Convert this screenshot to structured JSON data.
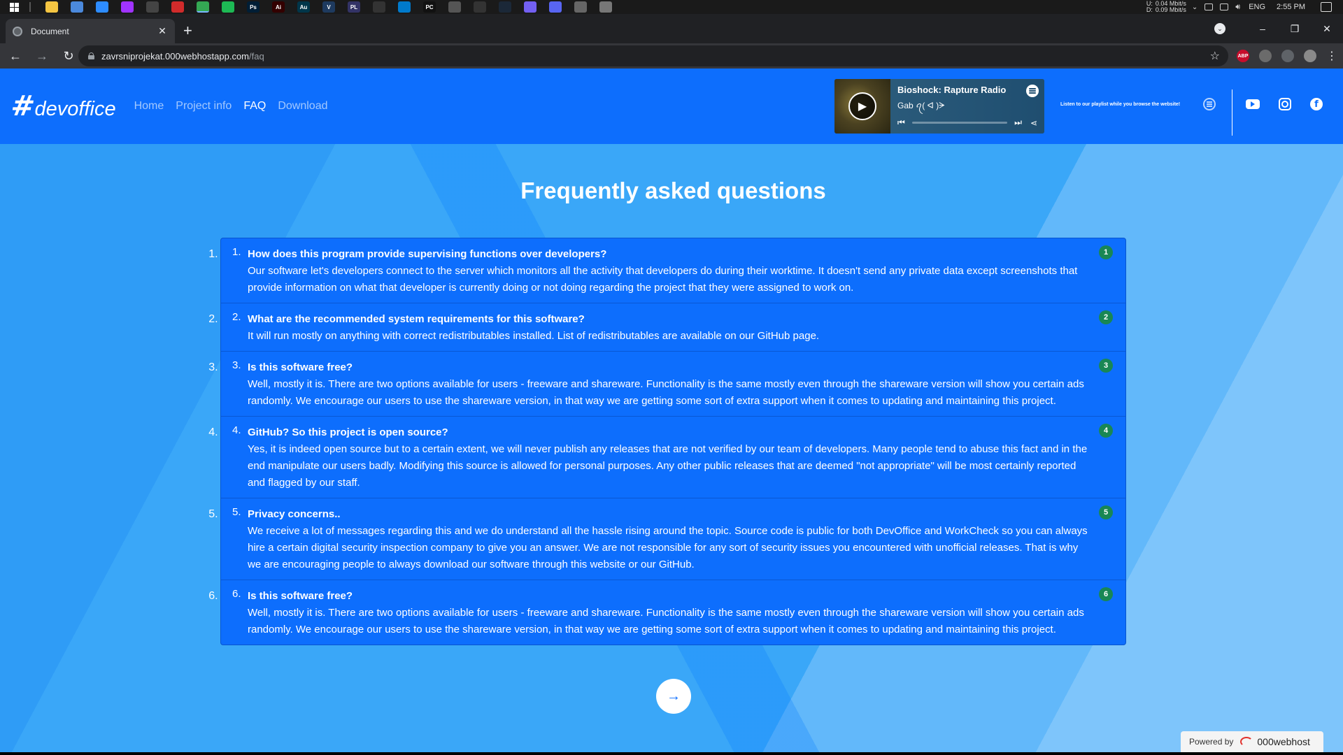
{
  "taskbar": {
    "apps": [
      {
        "name": "start-menu"
      },
      {
        "name": "file-explorer-icon",
        "color": "#f4c542"
      },
      {
        "name": "browser-app-icon",
        "color": "#4b89dc"
      },
      {
        "name": "zoom-icon",
        "color": "#2d8cff"
      },
      {
        "name": "messenger-icon",
        "color": "#a033ff"
      },
      {
        "name": "github-app-icon",
        "color": "#444444"
      },
      {
        "name": "media-app-icon",
        "color": "#d12b2b"
      },
      {
        "name": "chrome-icon",
        "color": "#34a853"
      },
      {
        "name": "spotify-app-icon",
        "color": "#1db954"
      },
      {
        "name": "photoshop-icon",
        "color": "#001e36",
        "text": "Ps"
      },
      {
        "name": "illustrator-icon",
        "color": "#330000",
        "text": "Ai"
      },
      {
        "name": "audition-icon",
        "color": "#00364a",
        "text": "Au"
      },
      {
        "name": "visual-studio-icon",
        "color": "#1e3a5f",
        "text": "V"
      },
      {
        "name": "plugin-app-icon",
        "color": "#333366",
        "text": "PL"
      },
      {
        "name": "cursor-app-icon",
        "color": "#333333"
      },
      {
        "name": "vscode-icon",
        "color": "#007acc"
      },
      {
        "name": "pycharm-icon",
        "color": "#111111",
        "text": "PC"
      },
      {
        "name": "app-bar-icon",
        "color": "#555555"
      },
      {
        "name": "terminal-icon",
        "color": "#333333"
      },
      {
        "name": "steam-icon",
        "color": "#1b2838"
      },
      {
        "name": "viber-icon",
        "color": "#7360f2"
      },
      {
        "name": "discord-icon",
        "color": "#5865f2"
      },
      {
        "name": "app-cloud-icon",
        "color": "#666666"
      },
      {
        "name": "remote-desktop-icon",
        "color": "#777777"
      }
    ],
    "net_labels": [
      "U:",
      "D:"
    ],
    "net_values": [
      "0.04 Mbit/s",
      "0.09 Mbit/s"
    ],
    "language": "ENG",
    "time": "2:55 PM"
  },
  "browser": {
    "tab_title": "Document",
    "tab_close": "✕",
    "new_tab": "+",
    "url_host": "zavrsniprojekat.000webhostapp.com",
    "url_path": "/faq",
    "extensions": [
      {
        "name": "adblock-extension-icon",
        "text": "ABP",
        "color": "#c70d2c"
      },
      {
        "name": "extension-icon",
        "text": "",
        "color": "#6b6b6b"
      },
      {
        "name": "puzzle-extensions-icon",
        "text": "",
        "color": "#5f6368"
      },
      {
        "name": "profile-avatar-icon",
        "text": "",
        "color": "#8a8a8a"
      }
    ]
  },
  "site": {
    "logo_hash": "#",
    "logo_text": "devoffice",
    "nav": [
      {
        "label": "Home",
        "active": false
      },
      {
        "label": "Project info",
        "active": false
      },
      {
        "label": "FAQ",
        "active": true
      },
      {
        "label": "Download",
        "active": false
      }
    ],
    "player": {
      "title": "Bioshock: Rapture Radio",
      "artist": "Gab ꪖ( ᐊ )ᗒ"
    },
    "playlist_note": "Listen to our playlist while you browse the website!",
    "social": [
      "spotify",
      "youtube",
      "instagram",
      "facebook"
    ]
  },
  "faq": {
    "title": "Frequently asked questions",
    "items": [
      {
        "num": "1.",
        "badge": "1",
        "question": "How does this program provide supervising functions over developers?",
        "answer": "Our software let's developers connect to the server which monitors all the activity that developers do during their worktime. It doesn't send any private data except screenshots that provide information on what that developer is currently doing or not doing regarding the project that they were assigned to work on."
      },
      {
        "num": "2.",
        "badge": "2",
        "question": "What are the recommended system requirements for this software?",
        "answer": "It will run mostly on anything with correct redistributables installed. List of redistributables are available on our GitHub page."
      },
      {
        "num": "3.",
        "badge": "3",
        "question": "Is this software free?",
        "answer": "Well, mostly it is. There are two options available for users - freeware and shareware. Functionality is the same mostly even through the shareware version will show you certain ads randomly. We encourage our users to use the shareware version, in that way we are getting some sort of extra support when it comes to updating and maintaining this project."
      },
      {
        "num": "4.",
        "badge": "4",
        "question": "GitHub? So this project is open source?",
        "answer": "Yes, it is indeed open source but to a certain extent, we will never publish any releases that are not verified by our team of developers. Many people tend to abuse this fact and in the end manipulate our users badly. Modifying this source is allowed for personal purposes. Any other public releases that are deemed \"not appropriate\" will be most certainly reported and flagged by our staff."
      },
      {
        "num": "5.",
        "badge": "5",
        "question": "Privacy concerns..",
        "answer": "We receive a lot of messages regarding this and we do understand all the hassle rising around the topic. Source code is public for both DevOffice and WorkCheck so you can always hire a certain digital security inspection company to give you an answer. We are not responsible for any sort of security issues you encountered with unofficial releases. That is why we are encouraging people to always download our software through this website or our GitHub."
      },
      {
        "num": "6.",
        "badge": "6",
        "question": "Is this software free?",
        "answer": "Well, mostly it is. There are two options available for users - freeware and shareware. Functionality is the same mostly even through the shareware version will show you certain ads randomly. We encourage our users to use the shareware version, in that way we are getting some sort of extra support when it comes to updating and maintaining this project."
      }
    ]
  },
  "footer": {
    "powered_by": "Powered by",
    "host_name": "000webhost"
  },
  "colors": {
    "nav_blue": "#0d6efd",
    "badge_green": "#198754",
    "page_blue": "#3aa7f8"
  }
}
